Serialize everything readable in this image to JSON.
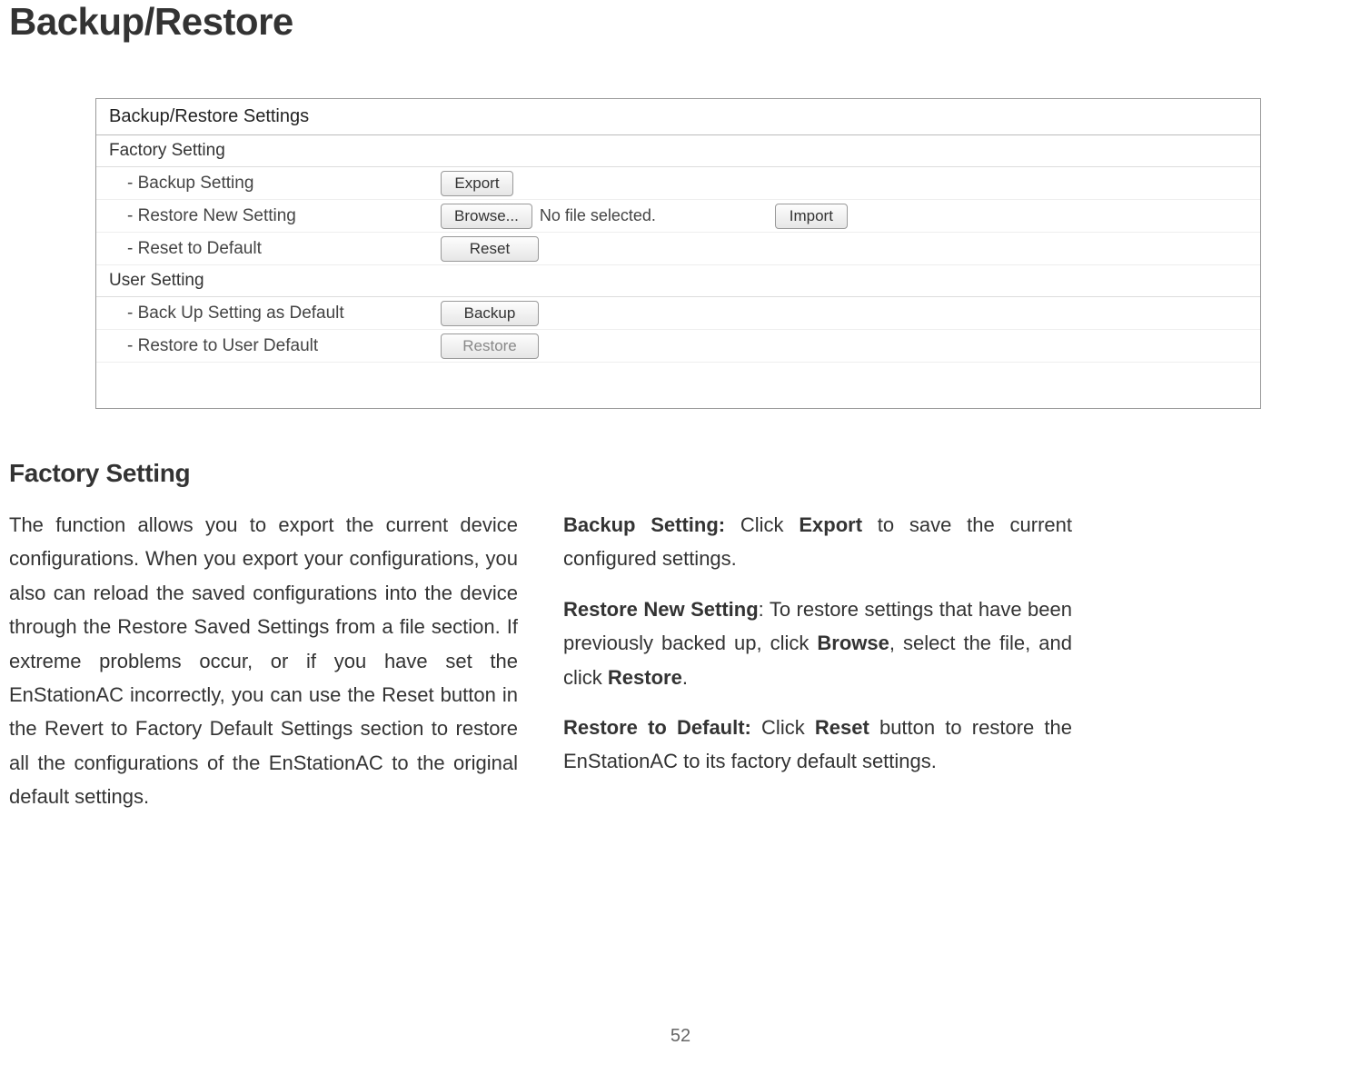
{
  "title": "Backup/Restore",
  "panel": {
    "header": "Backup/Restore Settings",
    "factory_section": "Factory Setting",
    "backup_setting_label": "- Backup Setting",
    "export_btn": "Export",
    "restore_new_label": "- Restore New Setting",
    "browse_btn": "Browse...",
    "file_status": "No file selected.",
    "import_btn": "Import",
    "reset_default_label": "- Reset to Default",
    "reset_btn": "Reset",
    "user_section": "User Setting",
    "backup_default_label": "- Back Up Setting as Default",
    "backup_btn": "Backup",
    "restore_user_label": "- Restore to User Default",
    "restore_btn": "Restore"
  },
  "subtitle": "Factory Setting",
  "col1_para": "The function allows you to export the current device configurations. When you export your configurations, you also can reload the saved configurations into the device through the Restore Saved Settings from a file section. If extreme problems occur, or if you have set the EnStationAC incorrectly, you can use the Reset button in the Revert to Factory Default Settings section to restore all the configurations of the EnStationAC to the original default settings.",
  "col2": {
    "backup_label": "Backup Setting:",
    "backup_text1": " Click ",
    "backup_bold": "Export",
    "backup_text2": " to save the current configured settings.",
    "restore_label": "Restore New Setting",
    "restore_text1": ": To restore settings that have been previously backed up, click ",
    "restore_bold1": "Browse",
    "restore_text2": ", select the file, and click ",
    "restore_bold2": "Restore",
    "restore_text3": ".",
    "default_label": "Restore to Default:",
    "default_text1": " Click ",
    "default_bold": "Reset",
    "default_text2": " button to restore the EnStationAC to its factory default settings."
  },
  "page_number": "52"
}
